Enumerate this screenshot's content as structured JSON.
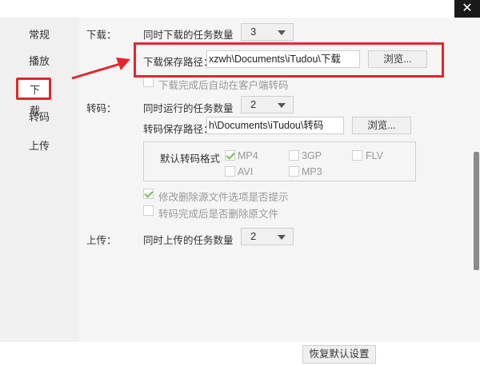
{
  "window": {
    "close_glyph": "✕"
  },
  "sidebar": {
    "items": [
      {
        "label": "常规"
      },
      {
        "label": "播放"
      },
      {
        "label": "下载"
      },
      {
        "label": "转码"
      },
      {
        "label": "上传"
      }
    ],
    "active_index": 2
  },
  "download": {
    "section_label": "下载：",
    "concurrent_label": "同时下载的任务数量",
    "concurrent_value": "3",
    "path_label": "下载保存路径：",
    "path_value": "xzwh\\Documents\\iTudou\\下载",
    "browse_label": "浏览...",
    "auto_transcode_label": "下载完成后自动在客户端转码",
    "auto_transcode_checked": false
  },
  "transcode": {
    "section_label": "转码：",
    "concurrent_label": "同时运行的任务数量",
    "concurrent_value": "2",
    "path_label": "转码保存路径：",
    "path_value": "h\\Documents\\iTudou\\转码",
    "browse_label": "浏览...",
    "default_format_label": "默认转码格式",
    "formats": [
      {
        "label": "MP4",
        "checked": true
      },
      {
        "label": "3GP",
        "checked": false
      },
      {
        "label": "FLV",
        "checked": false
      },
      {
        "label": "AVI",
        "checked": false
      },
      {
        "label": "MP3",
        "checked": false
      }
    ],
    "option_prompt_label": "修改删除源文件选项是否提示",
    "option_prompt_checked": true,
    "option_delete_label": "转码完成后是否删除原文件",
    "option_delete_checked": false
  },
  "upload": {
    "section_label": "上传：",
    "concurrent_label": "同时上传的任务数量",
    "concurrent_value": "2"
  },
  "footer": {
    "restore_label": "恢复默认设置"
  },
  "colors": {
    "highlight": "#e3262c",
    "check": "#6dbf4c"
  }
}
